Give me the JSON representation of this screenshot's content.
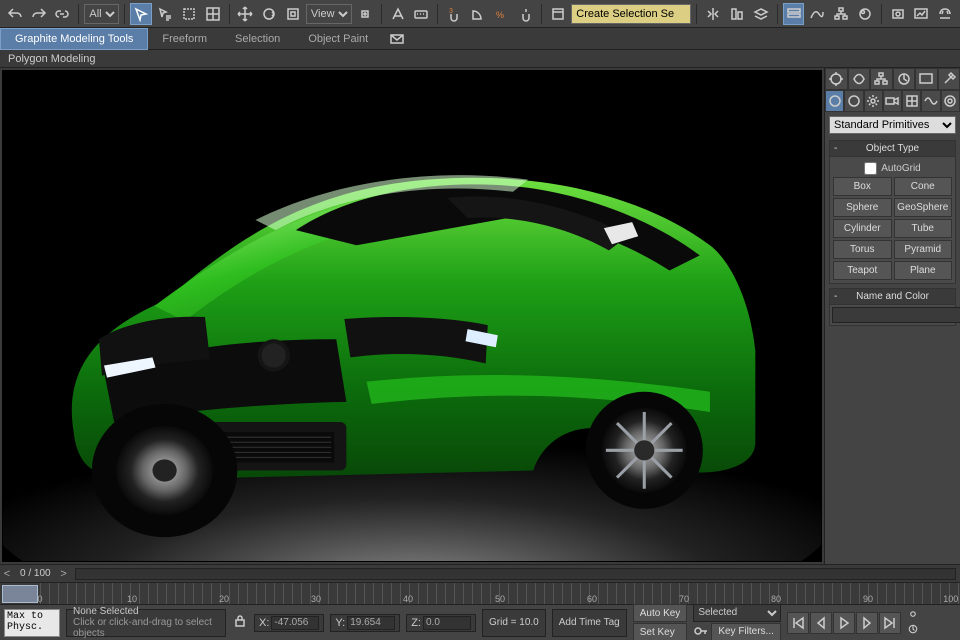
{
  "filter_dropdown": {
    "selected": "All"
  },
  "view_dropdown": {
    "selected": "View"
  },
  "selset_input": "Create Selection Se",
  "ribbon": {
    "tabs": [
      "Graphite Modeling Tools",
      "Freeform",
      "Selection",
      "Object Paint"
    ],
    "subribbon": "Polygon Modeling"
  },
  "cmdpanel": {
    "category_selected": "Standard Primitives",
    "object_type_header": "Object Type",
    "autogrid_label": "AutoGrid",
    "primitives": [
      "Box",
      "Cone",
      "Sphere",
      "GeoSphere",
      "Cylinder",
      "Tube",
      "Torus",
      "Pyramid",
      "Teapot",
      "Plane"
    ],
    "name_color_header": "Name and Color"
  },
  "timeline": {
    "frame_display": "0 / 100",
    "ticks": [
      0,
      10,
      20,
      30,
      40,
      50,
      60,
      70,
      80,
      90,
      100
    ]
  },
  "status": {
    "script_text": "Max to Physc.",
    "selection": "None Selected",
    "prompt": "Click or click-and-drag to select objects",
    "x": "-47.056",
    "y": "19.654",
    "z": "0.0",
    "grid": "Grid = 10.0",
    "add_time_tag": "Add Time Tag",
    "autokey": "Auto Key",
    "setkey": "Set Key",
    "key_mode_selected": "Selected",
    "key_filters": "Key Filters..."
  }
}
